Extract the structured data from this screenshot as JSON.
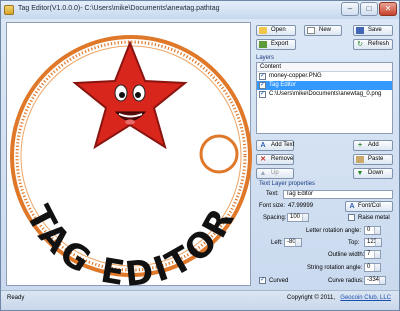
{
  "window": {
    "title": "Tag Editor(V1.0.0.0)- C:\\Users\\mike\\Documents\\anewtag.pathtag",
    "minimize": "–",
    "maximize": "□",
    "close": "✕"
  },
  "canvas": {
    "tag_text": "TAG EDITOR",
    "star_color": "#d9261c",
    "rim_color": "#e0782a"
  },
  "toolbar": {
    "open": "Open",
    "new": "New",
    "save": "Save",
    "export": "Export",
    "refresh": "Refresh"
  },
  "layers": {
    "label": "Layers",
    "header": "Content",
    "items": [
      {
        "label": "money-copper.PNG",
        "checked": true,
        "selected": false
      },
      {
        "label": "Tag Editor",
        "checked": true,
        "selected": true
      },
      {
        "label": "C:\\Users\\mike\\Documents\\anewtag_0.png",
        "checked": true,
        "selected": false
      }
    ]
  },
  "layer_actions": {
    "add_text": "Add Text",
    "add": "Add",
    "remove": "Remove",
    "paste": "Paste",
    "up": "Up",
    "down": "Down"
  },
  "properties": {
    "group_label": "Text Layer properties",
    "text_label": "Text:",
    "text_value": "Tag Editor",
    "font_size_label": "Font size:",
    "font_size_value": "47.99999",
    "font_button": "Font/Col",
    "spacing_label": "Spacing:",
    "spacing_value": "100",
    "raise_metal_label": "Raise metal",
    "letter_rotation_label": "Letter rotation angle:",
    "letter_rotation_value": "0",
    "left_label": "Left:",
    "left_value": "-80",
    "top_label": "Top:",
    "top_value": "123",
    "outline_width_label": "Outline width:",
    "outline_width_value": "7",
    "string_rotation_label": "String rotation angle:",
    "string_rotation_value": "0",
    "curved_label": "Curved",
    "curve_radius_label": "Curve radius:",
    "curve_radius_value": "-334"
  },
  "status": {
    "text": "Ready",
    "copyright": "Copyright © 2011,",
    "link": "Geocoin Club, LLC"
  }
}
